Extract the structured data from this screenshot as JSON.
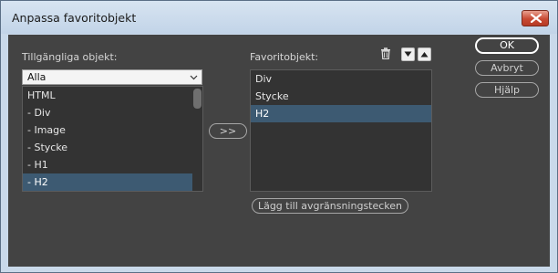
{
  "window": {
    "title": "Anpassa favoritobjekt"
  },
  "available": {
    "label": "Tillgängliga objekt:",
    "filter": "Alla",
    "items": [
      {
        "label": "HTML",
        "selected": false
      },
      {
        "label": "- Div",
        "selected": false
      },
      {
        "label": "- Image",
        "selected": false
      },
      {
        "label": "- Stycke",
        "selected": false
      },
      {
        "label": "- H1",
        "selected": false
      },
      {
        "label": "- H2",
        "selected": true
      }
    ]
  },
  "move_button": {
    "label": ">>"
  },
  "favorites": {
    "label": "Favoritobjekt:",
    "items": [
      {
        "label": "Div",
        "selected": false
      },
      {
        "label": "Stycke",
        "selected": false
      },
      {
        "label": "H2",
        "selected": true
      }
    ]
  },
  "separator_button": {
    "label": "Lägg till avgränsningstecken"
  },
  "actions": {
    "ok": "OK",
    "cancel": "Avbryt",
    "help": "Hjälp"
  },
  "icons": {
    "close": "close-icon",
    "delete": "trash-icon",
    "down": "move-down-icon",
    "up": "move-up-icon",
    "dropdown": "chevron-down-icon"
  }
}
